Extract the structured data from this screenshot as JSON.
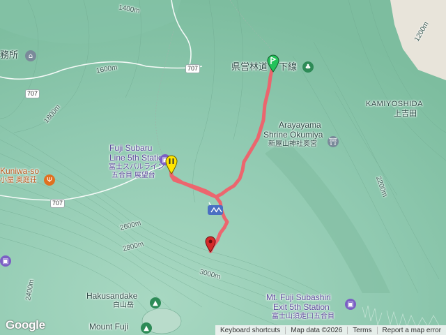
{
  "labels": {
    "prefectural_forest_road": "県営林道",
    "lower_line": "下線",
    "kamiyoshida_en": "KAMIYOSHIDA",
    "kamiyoshida_ja": "上吉田",
    "arayayama_1": "Arayayama",
    "arayayama_2": "Shrine Okumiya",
    "arayayama_ja": "新屋山神社奥宮",
    "fuji_subaru_1": "Fuji Subaru",
    "fuji_subaru_2": "Line 5th Station",
    "fuji_subaru_ja1": "富士スバルライン",
    "fuji_subaru_ja2": "五合目 展望台",
    "kuniwa_so": "Kuniwa-so",
    "kuniwa_ja": "小屋 奥庭荘",
    "office_ja": "務所",
    "hakusandake": "Hakusandake",
    "hakusandake_ja": "白山岳",
    "mount_fuji": "Mount Fuji",
    "subashiri_1": "Mt. Fuji Subashiri",
    "subashiri_2": "Exit 5th Station",
    "subashiri_ja": "富士山須走口五合目"
  },
  "road_numbers": [
    "707",
    "707",
    "707"
  ],
  "contours": {
    "c1400": "1400m",
    "c1600": "1600m",
    "c1800": "1800m",
    "c2600": "2600m",
    "c2800": "2800m",
    "c3000": "3000m",
    "c2400": "2400m",
    "c1200": "1200m",
    "c2200": "2200m"
  },
  "footer": {
    "keyboard": "Keyboard shortcuts",
    "map_data": "Map data ©2026",
    "terms": "Terms",
    "report": "Report a map error"
  },
  "brand": "Google",
  "colors": {
    "route": "#f0606a",
    "terrain": "#8fc9b0",
    "terrain_dark": "#6fb596",
    "urban": "#e6e2d8",
    "start_pin": "#23c25a",
    "end_pin": "#d42a2a",
    "station_pin": "#ffe500"
  }
}
